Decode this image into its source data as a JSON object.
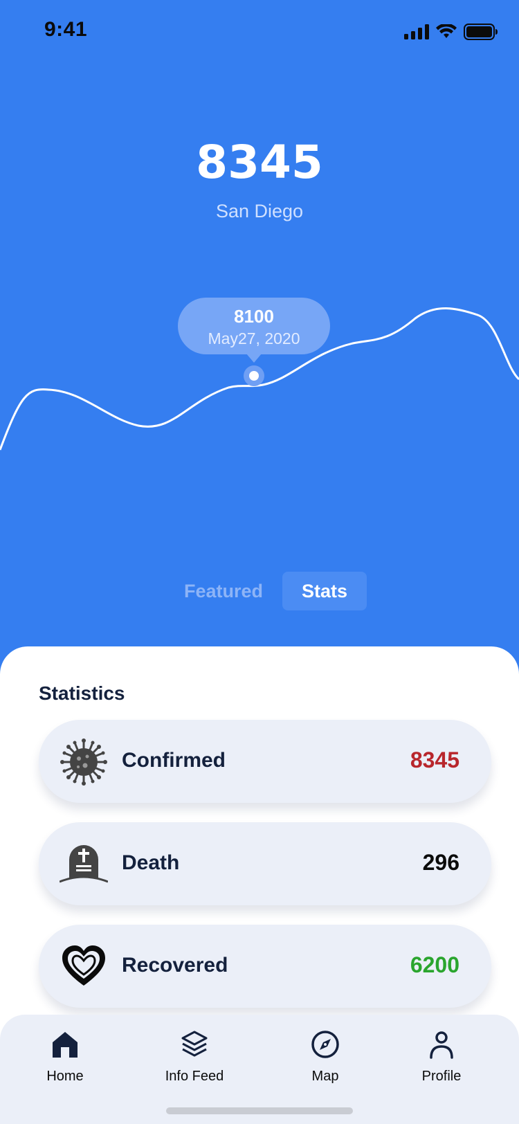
{
  "status_bar": {
    "time": "9:41"
  },
  "hero": {
    "value": "8345",
    "city": "San Diego"
  },
  "tooltip": {
    "value": "8100",
    "date": "May27, 2020"
  },
  "tabs_toggle": {
    "featured": "Featured",
    "stats": "Stats",
    "active": "stats"
  },
  "statistics": {
    "title": "Statistics",
    "items": [
      {
        "label": "Confirmed",
        "value": "8345",
        "color": "#b8262c",
        "icon": "virus-icon"
      },
      {
        "label": "Death",
        "value": "296",
        "color": "#0b0b0b",
        "icon": "tombstone-icon"
      },
      {
        "label": "Recovered",
        "value": "6200",
        "color": "#2aa52e",
        "icon": "heart-icon"
      }
    ]
  },
  "tab_bar": {
    "items": [
      {
        "label": "Home",
        "icon": "home-icon",
        "active": true
      },
      {
        "label": "Info Feed",
        "icon": "layers-icon"
      },
      {
        "label": "Map",
        "icon": "compass-icon"
      },
      {
        "label": "Profile",
        "icon": "profile-icon"
      }
    ]
  },
  "colors": {
    "primary": "#357ef0",
    "card": "#ebeff8",
    "dark_text": "#14213d"
  }
}
